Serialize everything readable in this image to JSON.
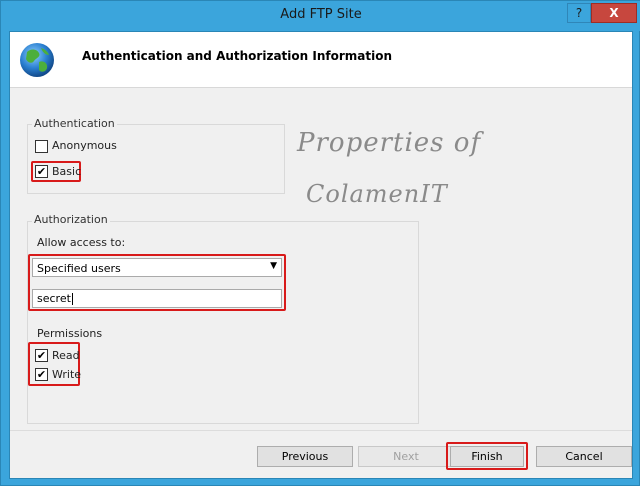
{
  "window": {
    "title": "Add FTP Site",
    "help_label": "?",
    "close_label": "X"
  },
  "header": {
    "title": "Authentication and Authorization Information",
    "icon": "globe-icon"
  },
  "authentication": {
    "group_title": "Authentication",
    "anonymous": {
      "label": "Anonymous",
      "checked": false
    },
    "basic": {
      "label": "Basic",
      "checked": true
    }
  },
  "authorization": {
    "group_title": "Authorization",
    "allow_label": "Allow access to:",
    "allow_value": "Specified users",
    "users_value": "secret"
  },
  "permissions": {
    "group_title": "Permissions",
    "read": {
      "label": "Read",
      "checked": true
    },
    "write": {
      "label": "Write",
      "checked": true
    }
  },
  "watermark": {
    "line1": "Properties of",
    "line2": "ColamenIT"
  },
  "buttons": {
    "previous": "Previous",
    "next": "Next",
    "finish": "Finish",
    "cancel": "Cancel"
  },
  "colors": {
    "accent": "#3ba5dc",
    "highlight": "#d81a1a",
    "close": "#c7473e"
  }
}
